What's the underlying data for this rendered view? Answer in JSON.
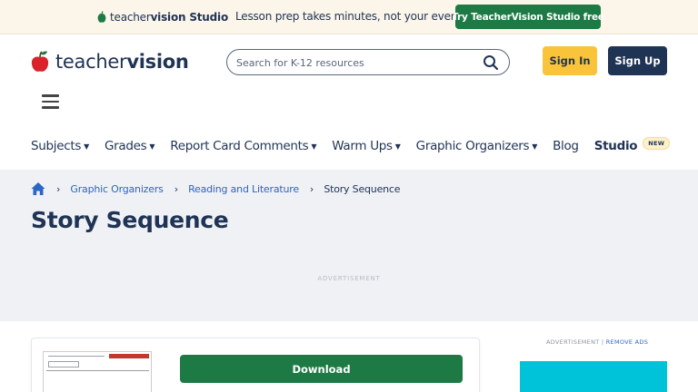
{
  "promo": {
    "brand_light": "teacher",
    "brand_bold": "vision",
    "brand_suffix": " Studio",
    "text": "Lesson prep takes minutes, not your evening.",
    "cta": "Try TeacherVision Studio free"
  },
  "header": {
    "logo_light": "teacher",
    "logo_bold": "vision",
    "search_placeholder": "Search for K-12 resources",
    "signin_label": "Sign In",
    "signup_label": "Sign Up"
  },
  "nav": {
    "items": [
      {
        "label": "Subjects",
        "caret": "▼"
      },
      {
        "label": "Grades",
        "caret": "▼"
      },
      {
        "label": "Report Card Comments",
        "caret": "▼"
      },
      {
        "label": "Warm Ups",
        "caret": "▼"
      },
      {
        "label": "Graphic Organizers",
        "caret": "▼"
      }
    ],
    "blog": "Blog",
    "studio": "Studio",
    "studio_badge": "NEW"
  },
  "breadcrumb": {
    "sep": "›",
    "items": [
      "Graphic Organizers",
      "Reading and Literature",
      "Story Sequence"
    ]
  },
  "page": {
    "title": "Story Sequence",
    "ad_label": "ADVERTISEMENT"
  },
  "content": {
    "download_label": "Download",
    "side_ad_label": "ADVERTISEMENT | ",
    "remove_ads": "REMOVE ADS"
  },
  "colors": {
    "brand_navy": "#1f3354",
    "brand_green": "#1d7a45",
    "signin_yellow": "#f9c43a",
    "link_blue": "#2a66c4",
    "hero_bg": "#eff1f5",
    "promo_bg": "#fbf5ea",
    "side_ad": "#00c2d8"
  }
}
